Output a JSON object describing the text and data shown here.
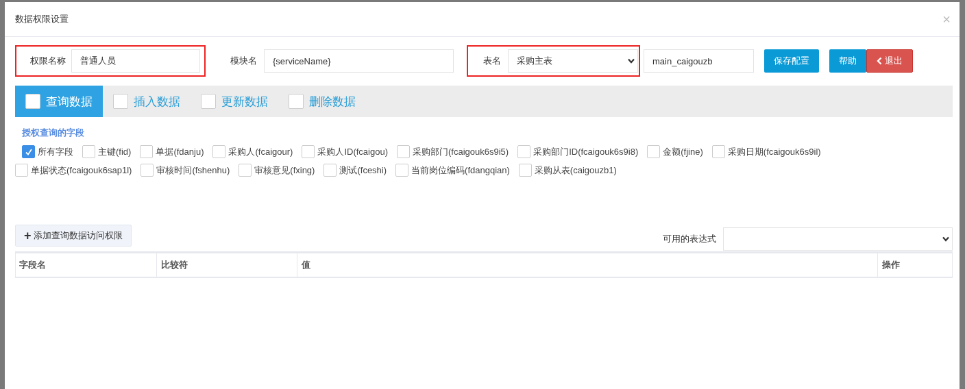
{
  "dialog": {
    "title": "数据权限设置",
    "close": "×"
  },
  "form": {
    "permission_name": {
      "label": "权限名称",
      "value": "普通人员",
      "highlighted": true
    },
    "module_name": {
      "label": "模块名",
      "value": "{serviceName}",
      "highlighted": false
    },
    "table_name": {
      "label": "表名",
      "value": "采购主表",
      "highlighted": true
    },
    "table_code": {
      "value": "main_caigouzb"
    },
    "buttons": [
      {
        "label": "保存配置",
        "kind": "primary"
      },
      {
        "label": "帮助",
        "kind": "primary"
      },
      {
        "label": "退出",
        "kind": "danger"
      }
    ]
  },
  "tabs": [
    {
      "label": "查询数据",
      "selected": true,
      "checked": false
    },
    {
      "label": "插入数据",
      "selected": false,
      "checked": false
    },
    {
      "label": "更新数据",
      "selected": false,
      "checked": false
    },
    {
      "label": "删除数据",
      "selected": false,
      "checked": false
    }
  ],
  "section_title": "授权查询的字段",
  "fields": [
    {
      "label": "所有字段",
      "checked": true
    },
    {
      "label": "主键(fid)",
      "checked": false
    },
    {
      "label": "单据(fdanju)",
      "checked": false
    },
    {
      "label": "采购人(fcaigour)",
      "checked": false
    },
    {
      "label": "采购人ID(fcaigou)",
      "checked": false
    },
    {
      "label": "采购部门(fcaigouk6s9i5)",
      "checked": false
    },
    {
      "label": "采购部门ID(fcaigouk6s9i8)",
      "checked": false
    },
    {
      "label": "金额(fjine)",
      "checked": false
    },
    {
      "label": "采购日期(fcaigouk6s9il)",
      "checked": false
    },
    {
      "label": "单据状态(fcaigouk6sap1l)",
      "checked": false
    },
    {
      "label": "审核时间(fshenhu)",
      "checked": false
    },
    {
      "label": "审核意见(fxing)",
      "checked": false
    },
    {
      "label": "测试(fceshi)",
      "checked": false
    },
    {
      "label": "当前岗位编码(fdangqian)",
      "checked": false
    },
    {
      "label": "采购从表(caigouzb1)",
      "checked": false
    }
  ],
  "add_button": {
    "icon": "+",
    "label": "添加查询数据访问权限"
  },
  "expression": {
    "label": "可用的表达式"
  },
  "table": {
    "columns": [
      "字段名",
      "比较符",
      "值",
      "操作"
    ]
  }
}
